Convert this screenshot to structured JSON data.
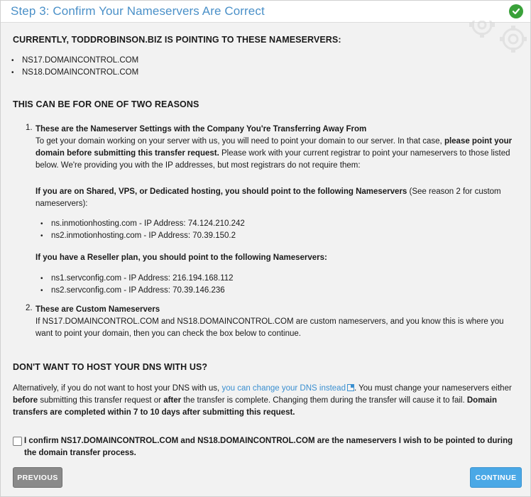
{
  "step_title": "Step 3: Confirm Your Nameservers Are Correct",
  "current": {
    "heading": "CURRENTLY, TODDROBINSON.BIZ IS POINTING TO THESE NAMESERVERS:",
    "nameservers": [
      "NS17.DOMAINCONTROL.COM",
      "NS18.DOMAINCONTROL.COM"
    ]
  },
  "reasons": {
    "heading": "THIS CAN BE FOR ONE OF TWO REASONS",
    "r1_num": "1.",
    "r1_title": "These are the Nameserver Settings with the Company You're Transferring Away From",
    "r1_p1_a": "To get your domain working on your server with us, you will need to point your domain to our server. In that case, ",
    "r1_p1_b": "please point your domain before submitting this transfer request.",
    "r1_p1_c": " Please work with your current registrar to point your nameservers to those listed below. We're providing you with the IP addresses, but most registrars do not require them:",
    "shared_bold": "If you are on Shared, VPS, or Dedicated hosting, you should point to the following Nameservers",
    "shared_rest": " (See reason 2 for custom nameservers):",
    "shared_ns": [
      "ns.inmotionhosting.com - IP Address: 74.124.210.242",
      "ns2.inmotionhosting.com - IP Address: 70.39.150.2"
    ],
    "reseller_bold": "If you have a Reseller plan, you should point to the following Nameservers:",
    "reseller_ns": [
      "ns1.servconfig.com - IP Address: 216.194.168.112",
      "ns2.servconfig.com - IP Address: 70.39.146.236"
    ],
    "r2_num": "2.",
    "r2_title": "These are Custom Nameservers",
    "r2_text": "If NS17.DOMAINCONTROL.COM and NS18.DOMAINCONTROL.COM are custom nameservers, and you know this is where you want to point your domain, then you can check the box below to continue."
  },
  "dns": {
    "heading": "DON'T WANT TO HOST YOUR DNS WITH US?",
    "p_a": "Alternatively, if you do not want to host your DNS with us, ",
    "link": "you can change your DNS instead",
    "p_b": ". You must change your nameservers either ",
    "p_c": "before",
    "p_d": " submitting this transfer request or ",
    "p_e": "after",
    "p_f": " the transfer is complete. Changing them during the transfer will cause it to fail. ",
    "p_g": "Domain transfers are completed within 7 to 10 days after submitting this request."
  },
  "confirm_text": "I confirm NS17.DOMAINCONTROL.COM and NS18.DOMAINCONTROL.COM are the nameservers I wish to be pointed to during the domain transfer process.",
  "buttons": {
    "previous": "PREVIOUS",
    "continue": "CONTINUE"
  }
}
